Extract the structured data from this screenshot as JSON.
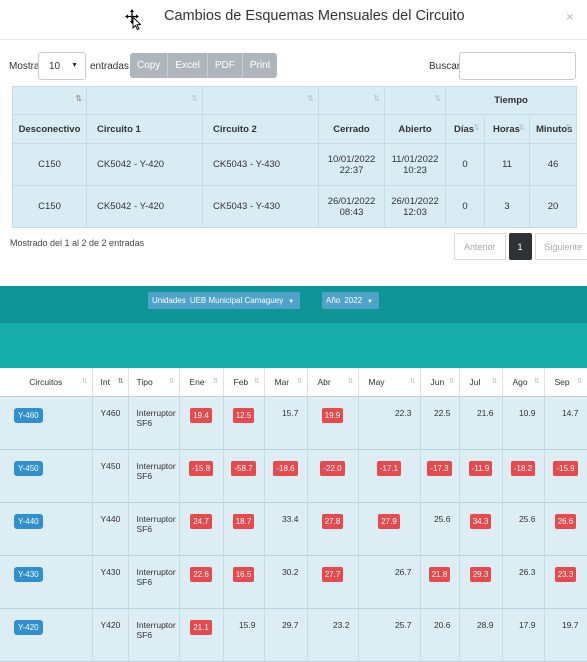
{
  "modal": {
    "title": "Cambios de Esquemas Mensuales del Circuito",
    "close_label": "×",
    "show_label": "Mostrar",
    "entries_label": "entradas",
    "page_length": "10",
    "buttons": [
      "Copy",
      "Excel",
      "PDF",
      "Print"
    ],
    "search_label": "Buscar:",
    "search_value": "",
    "table": {
      "group_header": "Tiempo",
      "columns": [
        "Desconectivo",
        "Circuito 1",
        "Circuito 2",
        "Cerrado",
        "Abierto",
        "Días",
        "Horas",
        "Minutos"
      ],
      "rows": [
        {
          "desconectivo": "C150",
          "circuito1": "CK5042 - Y-420",
          "circuito2": "CK5043 - Y-430",
          "cerrado_date": "10/01/2022",
          "cerrado_time": "22:37",
          "abierto_date": "11/01/2022",
          "abierto_time": "10:23",
          "dias": "0",
          "horas": "11",
          "minutos": "46"
        },
        {
          "desconectivo": "C150",
          "circuito1": "CK5042 - Y-420",
          "circuito2": "CK5043 - Y-430",
          "cerrado_date": "26/01/2022",
          "cerrado_time": "08:43",
          "abierto_date": "26/01/2022",
          "abierto_time": "12:03",
          "dias": "0",
          "horas": "3",
          "minutos": "20"
        }
      ]
    },
    "info": "Mostrado del 1 al 2 de 2 entradas",
    "pager": {
      "prev": "Anterior",
      "current": "1",
      "next": "Siguiente"
    }
  },
  "dashboard": {
    "unit_label": "Unidades",
    "unit_value": "UEB Municipal Camaguey",
    "year_label": "Año",
    "year_value": "2022",
    "columns": [
      "Circuitos",
      "Int",
      "Tipo",
      "Ene",
      "Feb",
      "Mar",
      "Abr",
      "May",
      "Jun",
      "Jul",
      "Ago",
      "Sep"
    ],
    "rows": [
      {
        "circuito": "Y-460",
        "int": "Y460",
        "tipo1": "Interruptor",
        "tipo2": "SF6",
        "months": [
          {
            "v": "19.4",
            "red": true
          },
          {
            "v": "12.5",
            "red": true
          },
          {
            "v": "15.7",
            "red": false
          },
          {
            "v": "19.9",
            "red": true
          },
          {
            "v": "22.3",
            "red": false
          },
          {
            "v": "22.5",
            "red": false
          },
          {
            "v": "21.6",
            "red": false
          },
          {
            "v": "10.9",
            "red": false
          },
          {
            "v": "14.7",
            "red": false
          }
        ]
      },
      {
        "circuito": "Y-450",
        "int": "Y450",
        "tipo1": "Interruptor",
        "tipo2": "SF6",
        "months": [
          {
            "v": "-15.8",
            "red": true
          },
          {
            "v": "-58.7",
            "red": true
          },
          {
            "v": "-18.6",
            "red": true
          },
          {
            "v": "-22.0",
            "red": true
          },
          {
            "v": "-17.1",
            "red": true
          },
          {
            "v": "-17.3",
            "red": true
          },
          {
            "v": "-11.9",
            "red": true
          },
          {
            "v": "-18.2",
            "red": true
          },
          {
            "v": "-15.9",
            "red": true
          }
        ]
      },
      {
        "circuito": "Y-440",
        "int": "Y440",
        "tipo1": "Interruptor",
        "tipo2": "SF6",
        "months": [
          {
            "v": "24.7",
            "red": true
          },
          {
            "v": "18.7",
            "red": true
          },
          {
            "v": "33.4",
            "red": false
          },
          {
            "v": "27.8",
            "red": true
          },
          {
            "v": "27.9",
            "red": true
          },
          {
            "v": "25.6",
            "red": false
          },
          {
            "v": "34.3",
            "red": true
          },
          {
            "v": "25.6",
            "red": false
          },
          {
            "v": "26.6",
            "red": true
          }
        ]
      },
      {
        "circuito": "Y-430",
        "int": "Y430",
        "tipo1": "Interruptor",
        "tipo2": "SF6",
        "months": [
          {
            "v": "22.6",
            "red": true
          },
          {
            "v": "16.5",
            "red": true
          },
          {
            "v": "30.2",
            "red": false
          },
          {
            "v": "27.7",
            "red": true
          },
          {
            "v": "26.7",
            "red": false
          },
          {
            "v": "21.8",
            "red": true
          },
          {
            "v": "29.3",
            "red": true
          },
          {
            "v": "26.3",
            "red": false
          },
          {
            "v": "23.3",
            "red": true
          }
        ]
      },
      {
        "circuito": "Y-420",
        "int": "Y420",
        "tipo1": "Interruptor",
        "tipo2": "SF6",
        "months": [
          {
            "v": "21.1",
            "red": true
          },
          {
            "v": "15.9",
            "red": false
          },
          {
            "v": "29.7",
            "red": false
          },
          {
            "v": "23.2",
            "red": false
          },
          {
            "v": "25.7",
            "red": false
          },
          {
            "v": "20.6",
            "red": false
          },
          {
            "v": "28.9",
            "red": false
          },
          {
            "v": "17.9",
            "red": false
          },
          {
            "v": "19.7",
            "red": false
          }
        ]
      }
    ]
  },
  "colors": {
    "accent_teal": "#0f9596",
    "band_teal": "#15aeab",
    "badge_red": "#e74a4c",
    "badge_blue": "#2f8fd0",
    "row_bg": "#d9ecf4"
  }
}
